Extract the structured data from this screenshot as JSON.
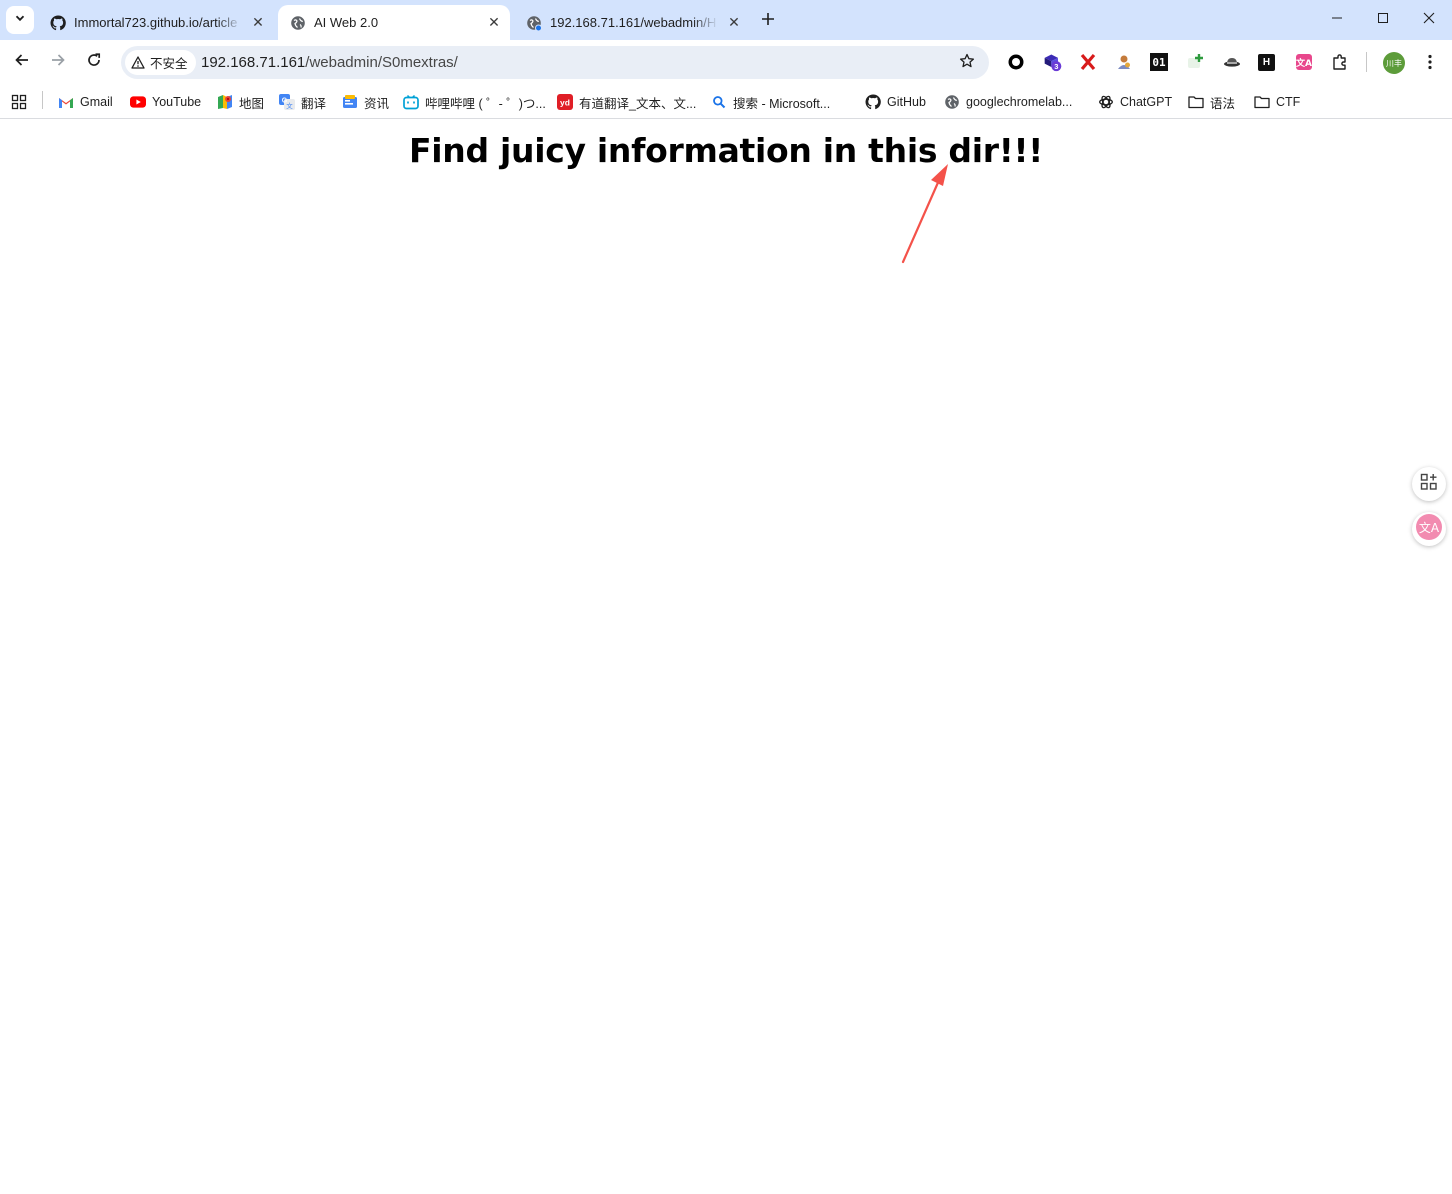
{
  "tabs": [
    {
      "title": "Immortal723.github.io/article",
      "favicon": "github-icon",
      "active": false
    },
    {
      "title": "AI Web 2.0",
      "favicon": "globe-icon",
      "active": true
    },
    {
      "title": "192.168.71.161/webadmin/H",
      "favicon": "globe-icon",
      "active": false
    }
  ],
  "omnibox": {
    "security_label": "不安全",
    "url_host": "192.168.71.161",
    "url_path": "/webadmin/S0mextras/"
  },
  "extensions": {
    "badge_count": "3",
    "ext_01_label": "01",
    "ext_h_label": "H",
    "profile_label": "川丰"
  },
  "bookmarks": [
    {
      "label": "Gmail",
      "icon": "gmail-icon"
    },
    {
      "label": "YouTube",
      "icon": "youtube-icon"
    },
    {
      "label": "地图",
      "icon": "maps-icon"
    },
    {
      "label": "翻译",
      "icon": "translate-icon"
    },
    {
      "label": "资讯",
      "icon": "news-icon"
    },
    {
      "label": "哔哩哔哩 ( ゜- ゜)つ...",
      "icon": "bilibili-icon"
    },
    {
      "label": "有道翻译_文本、文...",
      "icon": "youdao-icon"
    },
    {
      "label": "搜索 - Microsoft...",
      "icon": "search-icon"
    },
    {
      "label": "GitHub",
      "icon": "github-icon"
    },
    {
      "label": "googlechromelab...",
      "icon": "globe-icon"
    },
    {
      "label": "ChatGPT",
      "icon": "openai-icon"
    },
    {
      "label": "语法",
      "icon": "folder-icon"
    },
    {
      "label": "CTF",
      "icon": "folder-icon"
    }
  ],
  "page": {
    "heading": "Find juicy information in this dir!!!"
  },
  "colors": {
    "tabstrip_bg": "#d3e3fd",
    "omnibox_bg": "#e9eef6",
    "annotation_arrow": "#f4524a"
  }
}
